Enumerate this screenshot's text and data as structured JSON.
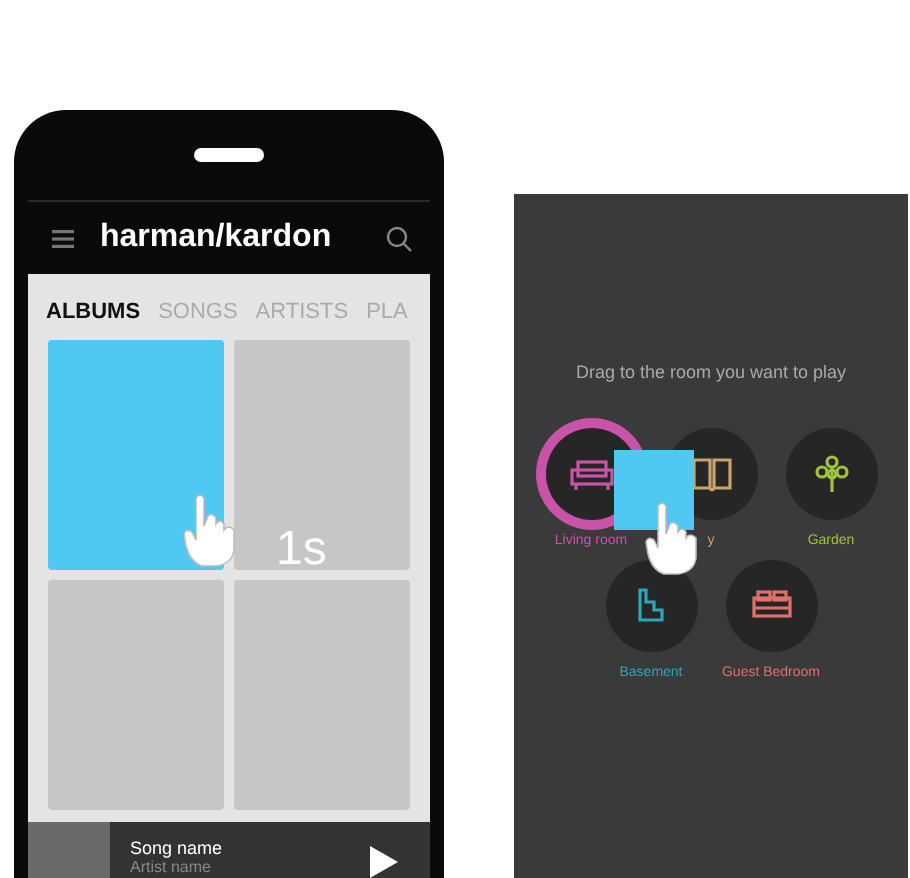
{
  "phone": {
    "brand": "harman/kardon",
    "tabs": [
      {
        "label": "ALBUMS",
        "selected": true
      },
      {
        "label": "SONGS",
        "selected": false
      },
      {
        "label": "ARTISTS",
        "selected": false
      },
      {
        "label": "PLA",
        "selected": false
      }
    ],
    "albums": [
      {
        "selected": true
      },
      {
        "selected": false
      },
      {
        "selected": false
      },
      {
        "selected": false
      }
    ],
    "hold_hint": "1s",
    "player": {
      "title": "Song name",
      "artist": "Artist name"
    }
  },
  "room_picker": {
    "prompt": "Drag to the room you want to play",
    "rows": [
      [
        {
          "name": "Living room",
          "kind": "sofa",
          "color": "#c853a8",
          "selected": true
        },
        {
          "name": "y",
          "kind": "book",
          "color": "#c9a46a",
          "selected": false
        },
        {
          "name": "Garden",
          "kind": "tree",
          "color": "#a3c23c",
          "selected": false
        }
      ],
      [
        {
          "name": "Basement",
          "kind": "stairs",
          "color": "#2aa7b8",
          "selected": false
        },
        {
          "name": "Guest Bedroom",
          "kind": "bed",
          "color": "#e0706a",
          "selected": false
        }
      ]
    ]
  }
}
